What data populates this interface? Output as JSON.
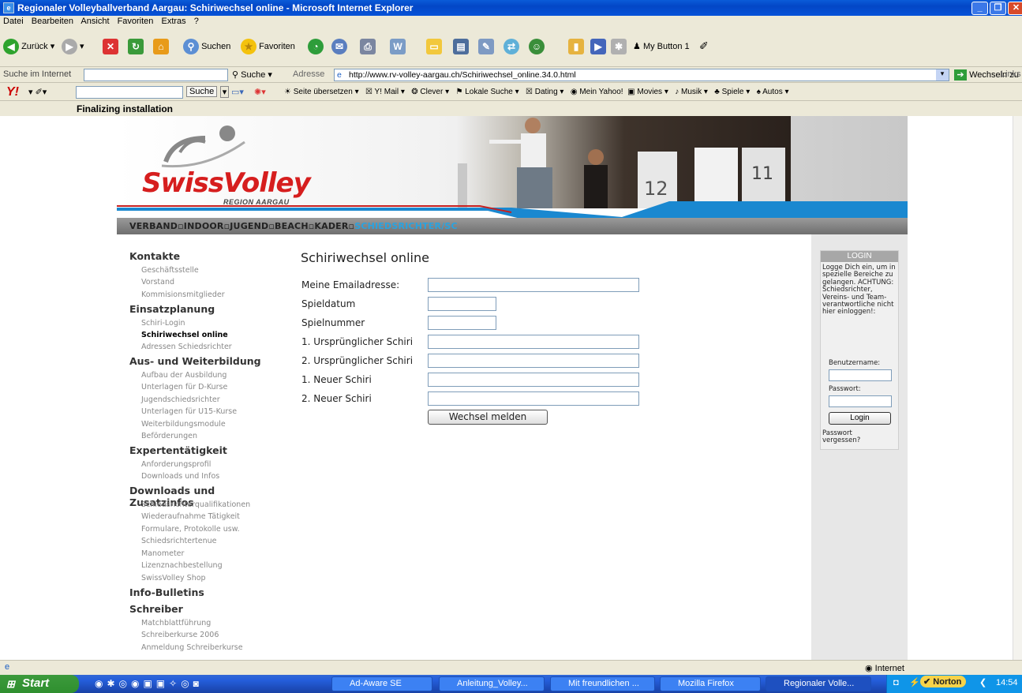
{
  "window": {
    "title": "Regionaler Volleyballverband Aargau: Schiriwechsel online - Microsoft Internet Explorer"
  },
  "menu": [
    "Datei",
    "Bearbeiten",
    "Ansicht",
    "Favoriten",
    "Extras",
    "?"
  ],
  "toolbar": {
    "back": "Zurück",
    "search": "Suchen",
    "favorites": "Favoriten",
    "mybutton": "My Button 1"
  },
  "address_row": {
    "search_label": "Suche im Internet",
    "search_button": "Suche",
    "address_label": "Adresse",
    "url": "http://www.rv-volley-aargau.ch/Schiriwechsel_online.34.0.html",
    "go": "Wechseln zu",
    "links": "Links"
  },
  "yahoo_bar": {
    "search_button": "Suche",
    "items": [
      "Seite übersetzen",
      "Y! Mail",
      "Clever",
      "Lokale Suche",
      "Dating",
      "Mein Yahoo!",
      "Movies",
      "Musik",
      "Spiele",
      "Autos"
    ]
  },
  "notice": "Finalizing installation",
  "site": {
    "logo": "SwissVolley",
    "logo_sub": "REGION AARGAU",
    "nav": [
      "VERBAND",
      "INDOOR",
      "JUGEND",
      "BEACH",
      "KADER",
      "SCHIEDSRICHTER/SC"
    ]
  },
  "sidebar": [
    {
      "heading": "Kontakte",
      "items": [
        "Geschäftsstelle",
        "Vorstand",
        "Kommisionsmitglieder"
      ]
    },
    {
      "heading": "Einsatzplanung",
      "items": [
        "Schiri-Login",
        "Schiriwechsel online",
        "Adressen Schiedsrichter"
      ]
    },
    {
      "heading": "Aus- und Weiterbildung",
      "items": [
        "Aufbau der Ausbildung",
        "Unterlagen für D-Kurse",
        "Jugendschiedsrichter",
        "Unterlagen für U15-Kurse",
        "Weiterbildungsmodule",
        "Beförderungen"
      ]
    },
    {
      "heading": "Expertentätigkeit",
      "items": [
        "Anforderungsprofil",
        "Downloads und Infos"
      ]
    },
    {
      "heading": "Downloads und Zusatzinfos",
      "items": [
        "Schiedsrichterqualifikationen",
        "Wiederaufnahme Tätigkeit",
        "Formulare, Protokolle usw.",
        "Schiedsrichtertenue",
        "Manometer",
        "Lizenznachbestellung",
        "SwissVolley Shop"
      ]
    },
    {
      "heading": "Info-Bulletins",
      "items": []
    },
    {
      "heading": "Schreiber",
      "items": [
        "Matchblattführung",
        "Schreiberkurse 2006",
        "Anmeldung Schreiberkurse"
      ]
    }
  ],
  "form": {
    "title": "Schiriwechsel online",
    "fields": [
      "Meine Emailadresse:",
      "Spieldatum",
      "Spielnummer",
      "1. Ursprünglicher Schiri",
      "2. Ursprünglicher Schiri",
      "1. Neuer Schiri",
      "2. Neuer Schiri"
    ],
    "submit": "Wechsel melden"
  },
  "login": {
    "heading": "LOGIN",
    "text": "Logge Dich ein, um in spezielle Bereiche zu gelangen. ACHTUNG: Schiedsrichter, Vereins- und Team-verantwortliche nicht hier einloggen!:",
    "user_label": "Benutzername:",
    "pass_label": "Passwort:",
    "button": "Login",
    "forgot": "Passwort vergessen?"
  },
  "status": {
    "zone": "Internet"
  },
  "taskbar": {
    "start": "Start",
    "tasks": [
      "Ad-Aware SE",
      "Anleitung_Volley...",
      "Mit freundlichen ...",
      "Mozilla Firefox",
      "Regionaler Volle..."
    ],
    "norton": "Norton",
    "clock": "14:54"
  }
}
